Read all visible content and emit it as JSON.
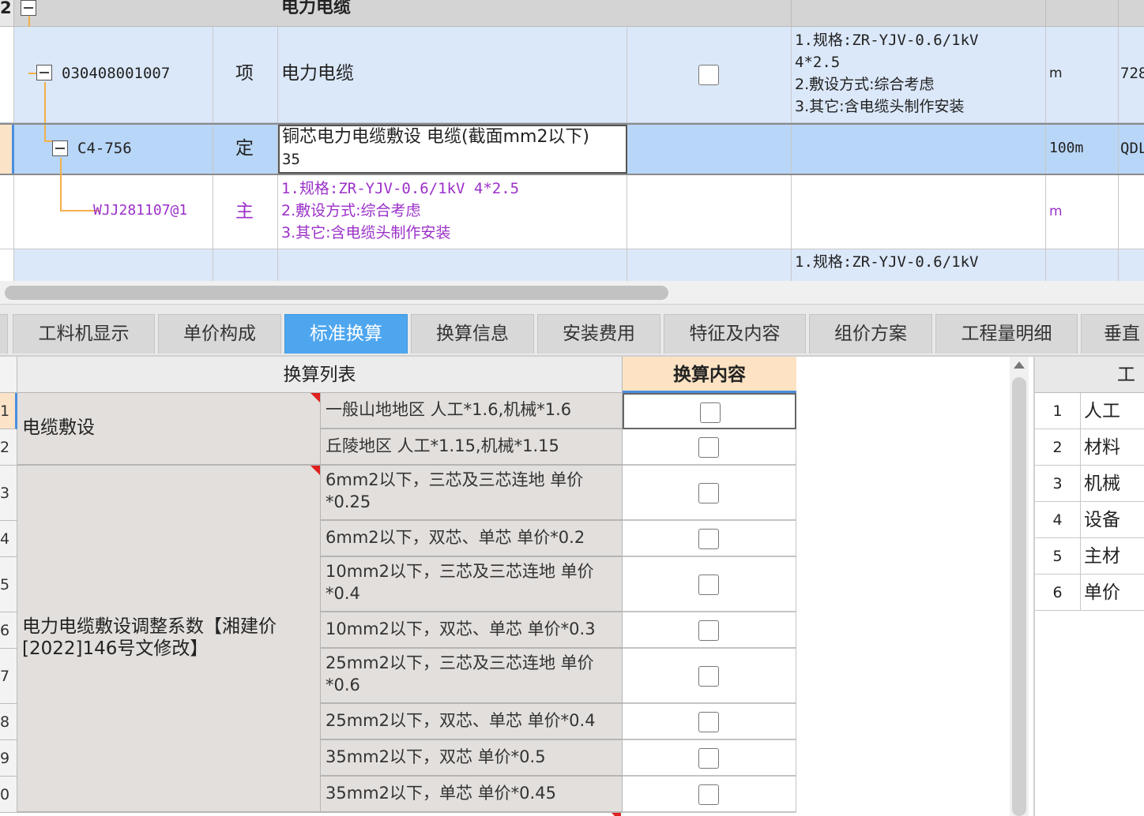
{
  "top_grid": {
    "head_row": {
      "row_number": "2",
      "name": "电力电缆"
    },
    "qd_row": {
      "code": "030408001007",
      "type": "项",
      "name": "电力电缆",
      "features": [
        "1.规格:ZR-YJV-0.6/1kV",
        "4*2.5",
        "2.敷设方式:综合考虑",
        "3.其它:含电缆头制作安装"
      ],
      "unit": "m",
      "quantity": "728"
    },
    "de_row": {
      "code": "C4-756",
      "type": "定",
      "name_line1": "铜芯电力电缆敷设 电缆(截面mm2以下)",
      "name_line2": "35",
      "unit": "100m",
      "quantity": "QDL"
    },
    "zc_row": {
      "code": "WJJ281107@1",
      "type": "主",
      "features": [
        "1.规格:ZR-YJV-0.6/1kV 4*2.5",
        "2.敷设方式:综合考虑",
        "3.其它:含电缆头制作安装"
      ],
      "unit": "m"
    },
    "next_row": {
      "features_line1": "1.规格:ZR-YJV-0.6/1kV"
    }
  },
  "tabs": [
    {
      "label": "工料机显示",
      "active": false
    },
    {
      "label": "单价构成",
      "active": false
    },
    {
      "label": "标准换算",
      "active": true
    },
    {
      "label": "换算信息",
      "active": false
    },
    {
      "label": "安装费用",
      "active": false
    },
    {
      "label": "特征及内容",
      "active": false
    },
    {
      "label": "组价方案",
      "active": false
    },
    {
      "label": "工程量明细",
      "active": false
    },
    {
      "label": "垂直",
      "active": false
    }
  ],
  "conversion_table": {
    "header_list": "换算列表",
    "header_content": "换算内容",
    "groups": [
      {
        "label": "电缆敷设"
      },
      {
        "label_line1": "电力电缆敷设调整系数【湘建价",
        "label_line2": "[2022]146号文修改】"
      }
    ],
    "rows": [
      {
        "num": "1",
        "text": "一般山地地区 人工*1.6,机械*1.6",
        "checked": false
      },
      {
        "num": "2",
        "text": "丘陵地区 人工*1.15,机械*1.15",
        "checked": false
      },
      {
        "num": "3",
        "text": "6mm2以下，三芯及三芯连地 单价*0.25",
        "checked": false
      },
      {
        "num": "4",
        "text": "6mm2以下，双芯、单芯 单价*0.2",
        "checked": false
      },
      {
        "num": "5",
        "text": "10mm2以下，三芯及三芯连地 单价*0.4",
        "checked": false
      },
      {
        "num": "6",
        "text": "10mm2以下，双芯、单芯 单价*0.3",
        "checked": false
      },
      {
        "num": "7",
        "text": "25mm2以下，三芯及三芯连地 单价*0.6",
        "checked": false
      },
      {
        "num": "8",
        "text": "25mm2以下，双芯、单芯 单价*0.4",
        "checked": false
      },
      {
        "num": "9",
        "text": "35mm2以下，双芯 单价*0.5",
        "checked": false
      },
      {
        "num": "0",
        "text": "35mm2以下，单芯 单价*0.45",
        "checked": false
      }
    ]
  },
  "right_panel": {
    "header": "工",
    "items": [
      {
        "num": "1",
        "label": "人工"
      },
      {
        "num": "2",
        "label": "材料"
      },
      {
        "num": "3",
        "label": "机械"
      },
      {
        "num": "4",
        "label": "设备"
      },
      {
        "num": "5",
        "label": "主材"
      },
      {
        "num": "6",
        "label": "单价"
      }
    ]
  },
  "colors": {
    "active_tab": "#4ea6ef",
    "selected_row": "#b8d6f7",
    "qd_row": "#dbe8f9",
    "main_material_text": "#9b30c8",
    "tree_line": "#f2b04a",
    "group_cell": "#e2dfdd"
  }
}
